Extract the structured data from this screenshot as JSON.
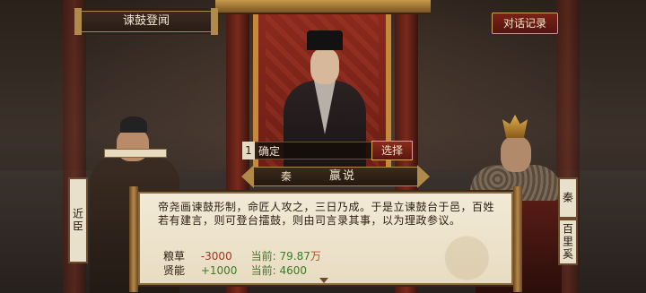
{
  "header": {
    "event_title": "谏鼓登闻",
    "dialog_log_label": "对话记录"
  },
  "choice": {
    "index": "1",
    "text": "确定",
    "select_label": "选择"
  },
  "speaker": {
    "state": "秦",
    "name": "嬴说"
  },
  "left_character": {
    "title": "近臣"
  },
  "right_character": {
    "state": "秦",
    "name": "百里奚"
  },
  "dialogue": {
    "text": "帝尧画谏鼓形制，命匠人攻之，三日乃成。于是立谏鼓台于邑，百姓若有建言，则可登台擂鼓，则由司言录其事，以为理政参议。",
    "stats": [
      {
        "label": "粮草",
        "delta": "-3000",
        "current_label": "当前:",
        "current_value": "79.87",
        "unit": "万"
      },
      {
        "label": "贤能",
        "delta": "+1000",
        "current_label": "当前:",
        "current_value": "4600",
        "unit": ""
      }
    ]
  },
  "colors": {
    "negative": "#a8321e",
    "positive": "#3f7a2a",
    "button_red": "#7a2218",
    "gold_trim": "#b08a4a"
  }
}
